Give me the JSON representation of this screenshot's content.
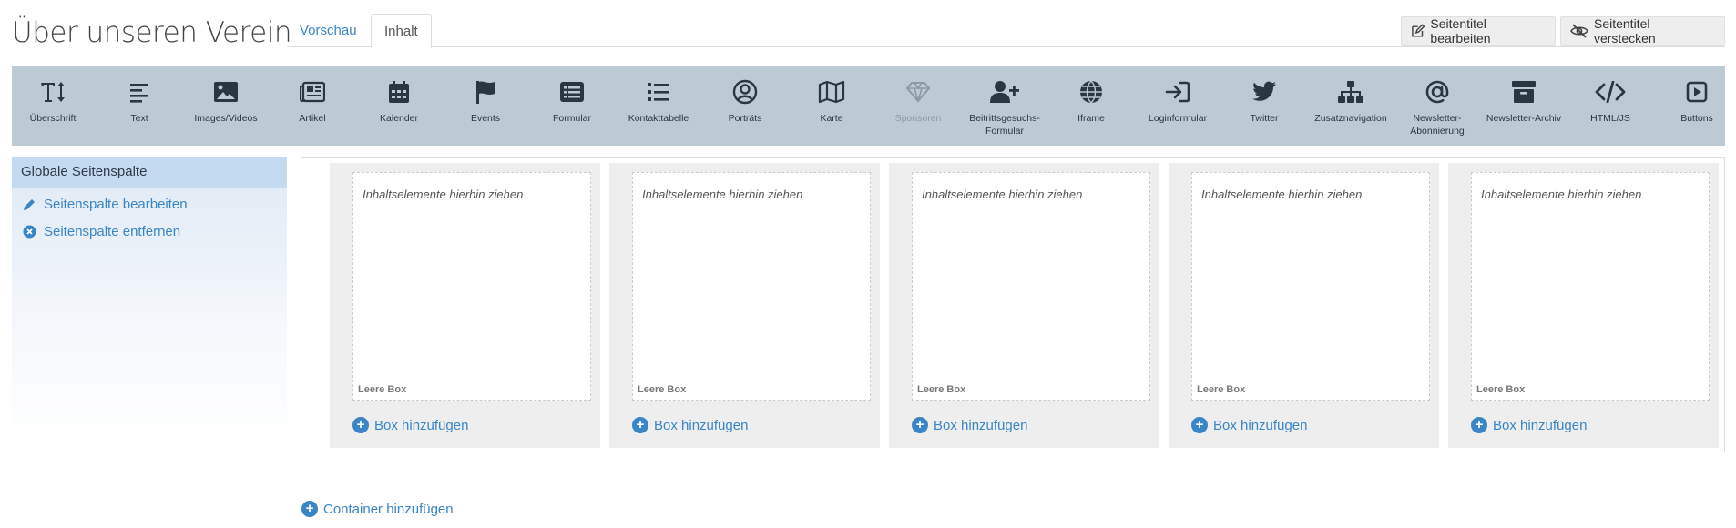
{
  "page": {
    "title": "Über unseren Verein"
  },
  "tabs": {
    "preview": "Vorschau",
    "content": "Inhalt"
  },
  "header_buttons": {
    "edit_title": "Seitentitel bearbeiten",
    "hide_title": "Seitentitel verstecken"
  },
  "toolbar": {
    "items": [
      {
        "label": "Überschrift",
        "icon": "text-height-icon"
      },
      {
        "label": "Text",
        "icon": "align-left-icon"
      },
      {
        "label": "Images/Videos",
        "icon": "image-icon"
      },
      {
        "label": "Artikel",
        "icon": "newspaper-icon"
      },
      {
        "label": "Kalender",
        "icon": "calendar-icon"
      },
      {
        "label": "Events",
        "icon": "flag-icon"
      },
      {
        "label": "Formular",
        "icon": "list-alt-icon"
      },
      {
        "label": "Kontakttabelle",
        "icon": "list-icon"
      },
      {
        "label": "Porträts",
        "icon": "user-circle-icon"
      },
      {
        "label": "Karte",
        "icon": "map-icon"
      },
      {
        "label": "Sponsoren",
        "icon": "gem-icon"
      },
      {
        "label": "Beitrittsgesuchs-Formular",
        "icon": "user-plus-icon"
      },
      {
        "label": "Iframe",
        "icon": "globe-icon"
      },
      {
        "label": "Loginformular",
        "icon": "sign-in-icon"
      },
      {
        "label": "Twitter",
        "icon": "twitter-icon"
      },
      {
        "label": "Zusatznavigation",
        "icon": "sitemap-icon"
      },
      {
        "label": "Newsletter-Abonnierung",
        "icon": "at-icon"
      },
      {
        "label": "Newsletter-Archiv",
        "icon": "archive-icon"
      },
      {
        "label": "HTML/JS",
        "icon": "code-icon"
      },
      {
        "label": "Buttons",
        "icon": "play-square-icon"
      }
    ]
  },
  "sidebar": {
    "title": "Globale Seitenspalte",
    "edit_link": "Seitenspalte bearbeiten",
    "remove_link": "Seitenspalte entfernen"
  },
  "columns": [
    {
      "placeholder": "Inhaltselemente hierhin ziehen",
      "empty_label": "Leere Box",
      "add_label": "Box hinzufügen"
    },
    {
      "placeholder": "Inhaltselemente hierhin ziehen",
      "empty_label": "Leere Box",
      "add_label": "Box hinzufügen"
    },
    {
      "placeholder": "Inhaltselemente hierhin ziehen",
      "empty_label": "Leere Box",
      "add_label": "Box hinzufügen"
    },
    {
      "placeholder": "Inhaltselemente hierhin ziehen",
      "empty_label": "Leere Box",
      "add_label": "Box hinzufügen"
    },
    {
      "placeholder": "Inhaltselemente hierhin ziehen",
      "empty_label": "Leere Box",
      "add_label": "Box hinzufügen"
    }
  ],
  "add_container": "Container hinzufügen",
  "colors": {
    "accent": "#3a85c6",
    "toolbar_bg": "#bccad3",
    "icon": "#2a3742",
    "disabled_icon": "#8e9aa3"
  }
}
